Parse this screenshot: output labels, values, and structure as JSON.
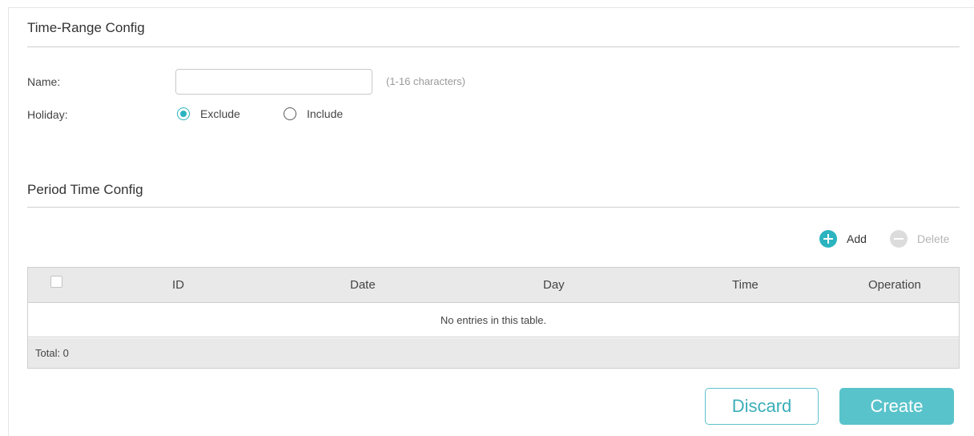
{
  "time_range_section": {
    "title": "Time-Range Config",
    "name_label": "Name:",
    "name_value": "",
    "name_hint": "(1-16 characters)",
    "holiday_label": "Holiday:",
    "holiday_options": [
      {
        "label": "Exclude",
        "checked": true
      },
      {
        "label": "Include",
        "checked": false
      }
    ]
  },
  "period_section": {
    "title": "Period Time Config",
    "add_label": "Add",
    "delete_label": "Delete",
    "add_icon": "plus-circle-icon",
    "delete_icon": "minus-circle-icon"
  },
  "table": {
    "columns": [
      "ID",
      "Date",
      "Day",
      "Time",
      "Operation"
    ],
    "empty_message": "No entries in this table.",
    "total_label": "Total: 0"
  },
  "actions": {
    "discard_label": "Discard",
    "create_label": "Create"
  },
  "colors": {
    "accent": "#2bb3bf",
    "create_button": "#59c3cb",
    "disabled_icon": "#dcdcdc",
    "table_header_bg": "#e9e9e9"
  }
}
